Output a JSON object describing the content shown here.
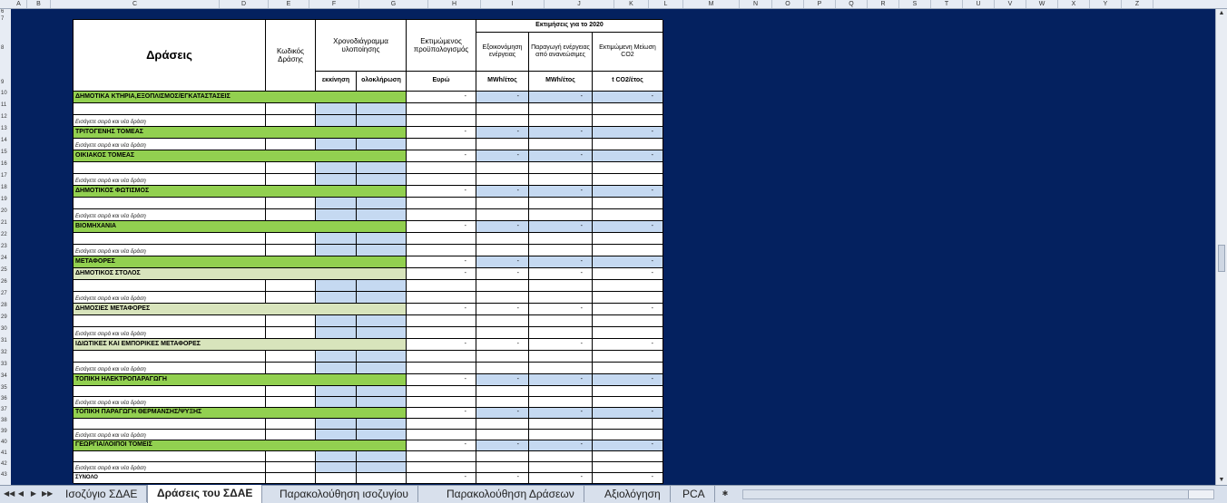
{
  "column_letters": [
    "A",
    "B",
    "C",
    "D",
    "E",
    "F",
    "G",
    "H",
    "I",
    "J",
    "K",
    "L",
    "M",
    "N",
    "O",
    "P",
    "Q",
    "R",
    "S",
    "T",
    "U",
    "V",
    "W",
    "X",
    "Y",
    "Z"
  ],
  "row_numbers": [
    "6",
    "7",
    "8",
    "9",
    "10",
    "11",
    "12",
    "13",
    "14",
    "15",
    "16",
    "17",
    "18",
    "19",
    "20",
    "21",
    "22",
    "23",
    "24",
    "25",
    "26",
    "27",
    "28",
    "29",
    "30",
    "31",
    "32",
    "33",
    "34",
    "35",
    "36",
    "37",
    "38",
    "39",
    "40",
    "41",
    "42",
    "43"
  ],
  "header": {
    "actions": "Δράσεις",
    "action_code": "Κωδικός Δράσης",
    "schedule": "Χρονοδιάγραμμα υλοποίησης",
    "start": "εκκίνηση",
    "end": "ολοκλήρωση",
    "budget": "Εκτιμώμενος προϋπολογισμός",
    "budget_unit": "Ευρώ",
    "estimates": "Εκτιμήσεις για το 2020",
    "energy_savings": "Εξοικονόμηση ενέργειας",
    "energy_savings_unit": "MWh/έτος",
    "renewables": "Παραγωγή ενέργειας από ανανεώσιμες",
    "renewables_unit": "MWh/έτος",
    "co2": "Εκτιμώμενη Μείωση CO2",
    "co2_unit": "t CO2/έτος"
  },
  "dash": "-",
  "hint_text": "Εισάγετε σειρά και νέα δράση",
  "total_label": "ΣΥΝΟΛΟ",
  "rows": [
    {
      "type": "section",
      "label": "ΔΗΜΟΤΙΚΑ ΚΤΗΡΙΑ,ΕΞΟΠΛΙΣΜΟΣ/ΕΓΚΑΤΑΣΤΑΣΕΙΣ",
      "shade": "green"
    },
    {
      "type": "blank"
    },
    {
      "type": "hint"
    },
    {
      "type": "section",
      "label": "ΤΡΙΤΟΓΕΝΗΣ ΤΟΜΕΑΣ",
      "shade": "green"
    },
    {
      "type": "hint"
    },
    {
      "type": "section",
      "label": "ΟΙΚΙΑΚΟΣ ΤΟΜΕΑΣ",
      "shade": "green"
    },
    {
      "type": "blank"
    },
    {
      "type": "hint"
    },
    {
      "type": "section",
      "label": "ΔΗΜΟΤΙΚΟΣ ΦΩΤΙΣΜΟΣ",
      "shade": "green"
    },
    {
      "type": "blank"
    },
    {
      "type": "hint"
    },
    {
      "type": "section",
      "label": "ΒΙΟΜΗΧΑΝΙΑ",
      "shade": "green"
    },
    {
      "type": "blank"
    },
    {
      "type": "hint"
    },
    {
      "type": "section",
      "label": "ΜΕΤΑΦΟΡΕΣ",
      "shade": "green"
    },
    {
      "type": "section",
      "label": "ΔΗΜΟΤΙΚΟΣ ΣΤΟΛΟΣ",
      "shade": "light"
    },
    {
      "type": "blank"
    },
    {
      "type": "hint"
    },
    {
      "type": "section",
      "label": "ΔΗΜΟΣΙΕΣ ΜΕΤΑΦΟΡΕΣ",
      "shade": "light"
    },
    {
      "type": "blank"
    },
    {
      "type": "hint"
    },
    {
      "type": "section",
      "label": "ΙΔΙΩΤΙΚΕΣ ΚΑΙ ΕΜΠΟΡΙΚΕΣ ΜΕΤΑΦΟΡΕΣ",
      "shade": "light"
    },
    {
      "type": "blank"
    },
    {
      "type": "hint"
    },
    {
      "type": "section",
      "label": "ΤΟΠΙΚΗ ΗΛΕΚΤΡΟΠΑΡΑΓΩΓΗ",
      "shade": "green"
    },
    {
      "type": "blank"
    },
    {
      "type": "hint"
    },
    {
      "type": "section",
      "label": "ΤΟΠΙΚΗ ΠΑΡΑΓΩΓΗ ΘΕΡΜΑΝΣΗΣ/ΨΥΞΗΣ",
      "shade": "green"
    },
    {
      "type": "blank"
    },
    {
      "type": "hint"
    },
    {
      "type": "section",
      "label": "ΓΕΩΡΓΙΑ/ΛΟΙΠΟΙ ΤΟΜΕΙΣ",
      "shade": "green"
    },
    {
      "type": "blank"
    },
    {
      "type": "hint"
    },
    {
      "type": "total"
    }
  ],
  "sheet_tabs": [
    "Ισοζύγιο ΣΔΑΕ",
    "Δράσεις του ΣΔΑΕ",
    "Παρακολούθηση ισοζυγίου",
    "Παρακολούθηση Δράσεων",
    "Αξιολόγηση",
    "PCA"
  ],
  "active_tab": "Δράσεις του ΣΔΑΕ",
  "nav_buttons": [
    "◀◀",
    "◀",
    "▶",
    "▶▶"
  ],
  "colors": {
    "window_bg": "#04215f",
    "green": "#92d050",
    "light_green": "#d8e4bc",
    "blue_cell": "#c5d9f1"
  }
}
